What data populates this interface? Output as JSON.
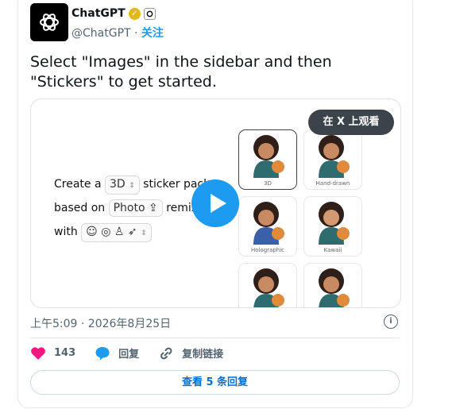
{
  "header": {
    "name": "ChatGPT",
    "handle": "@ChatGPT",
    "separator": " · ",
    "follow": "关注"
  },
  "tweet": {
    "text": "Select \"Images\" in the sidebar and then \"Stickers\" to get started."
  },
  "media": {
    "watch_label": "在 X 上观看",
    "prompt": {
      "create": "Create a",
      "style_value": "3D",
      "sticker": "sticker pack",
      "based_on": "based on",
      "photo": "Photo",
      "remix": "remix",
      "with": "with"
    },
    "tiles": [
      "3D",
      "Hand-drawn",
      "Holographic",
      "Kawaii",
      "",
      ""
    ]
  },
  "timestamp": "上午5:09 · 2026年8月25日",
  "actions": {
    "likes": "143",
    "reply": "回复",
    "copy_link": "复制链接"
  },
  "replies_button": "查看 5 条回复",
  "colors": {
    "accent": "#1d9bf0",
    "like": "#f91880",
    "link": "#006fd6"
  }
}
